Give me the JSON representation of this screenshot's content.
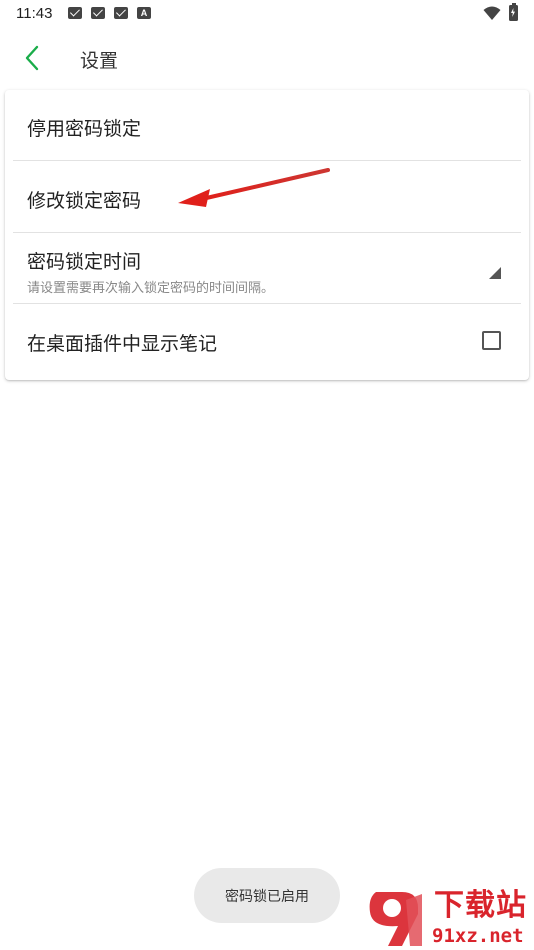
{
  "status_bar": {
    "time": "11:43",
    "notification_icons": [
      "mail-icon",
      "mail-icon",
      "mail-icon",
      "a-badge-icon"
    ],
    "notification_letter": "A",
    "wifi": "wifi-icon",
    "battery": "battery-charging-icon"
  },
  "header": {
    "title": "设置",
    "back_icon": "chevron-left-icon",
    "accent_color": "#1aad4a"
  },
  "settings": {
    "items": [
      {
        "label": "停用密码锁定"
      },
      {
        "label": "修改锁定密码"
      },
      {
        "label": "密码锁定时间",
        "summary": "请设置需要再次输入锁定密码的时间间隔。",
        "control": "dropdown-icon"
      },
      {
        "label": "在桌面插件中显示笔记",
        "control": "checkbox",
        "checked": false
      }
    ]
  },
  "annotation": {
    "type": "red-arrow-icon",
    "color": "#e0201b"
  },
  "toast": {
    "text": "密码锁已启用"
  },
  "watermark": {
    "title": "下载站",
    "domain": "91xz.net",
    "color": "#d9242c"
  }
}
